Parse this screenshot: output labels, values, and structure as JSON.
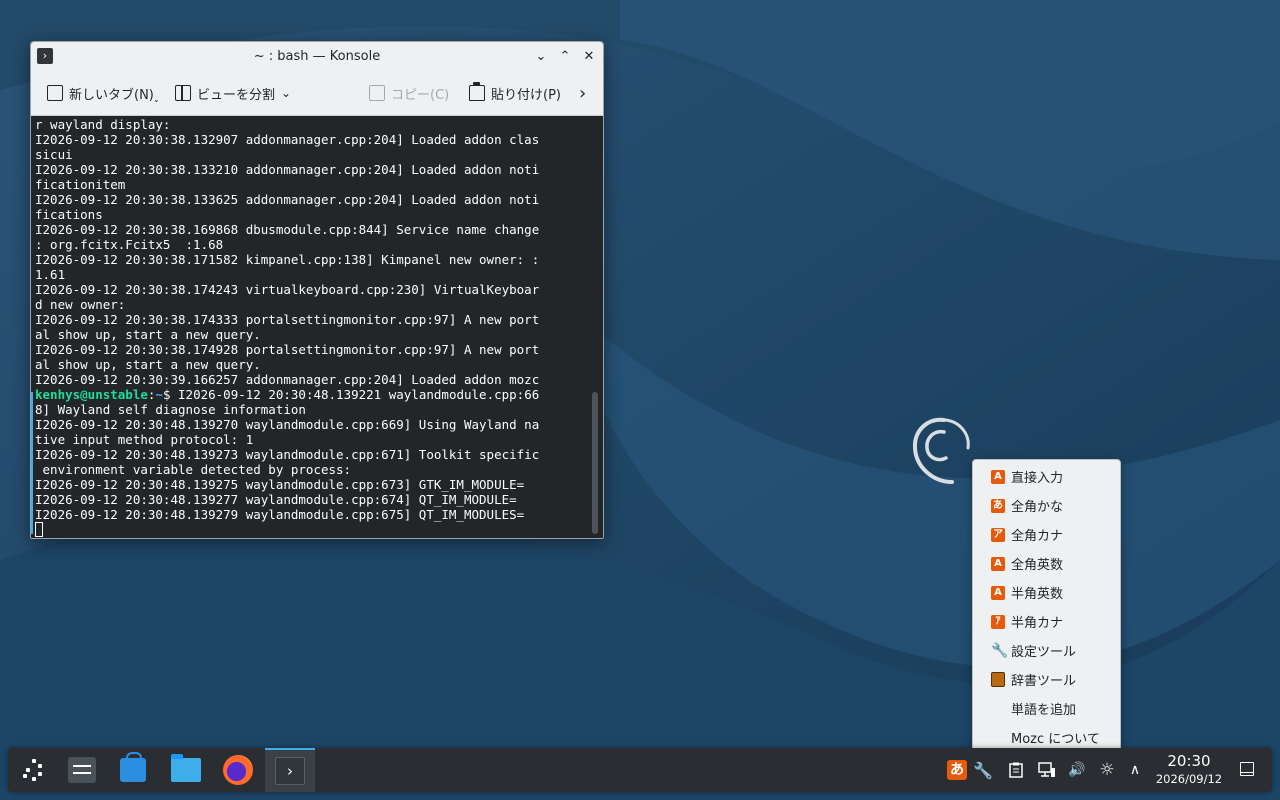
{
  "window": {
    "title": "~ : bash — Konsole",
    "min_glyph": "⌄",
    "max_glyph": "⌃",
    "close_glyph": "✕",
    "app_glyph": "›"
  },
  "toolbar": {
    "new_tab": "新しいタブ(N)",
    "split_view": "ビューを分割",
    "copy": "コピー(C)",
    "paste": "貼り付け(P)",
    "more_glyph": "›"
  },
  "terminal": {
    "lines_before": [
      "r wayland display:",
      "I2026-09-12 20:30:38.132907 addonmanager.cpp:204] Loaded addon clas",
      "sicui",
      "I2026-09-12 20:30:38.133210 addonmanager.cpp:204] Loaded addon noti",
      "ficationitem",
      "I2026-09-12 20:30:38.133625 addonmanager.cpp:204] Loaded addon noti",
      "fications",
      "I2026-09-12 20:30:38.169868 dbusmodule.cpp:844] Service name change",
      ": org.fcitx.Fcitx5  :1.68",
      "I2026-09-12 20:30:38.171582 kimpanel.cpp:138] Kimpanel new owner: :",
      "1.61",
      "I2026-09-12 20:30:38.174243 virtualkeyboard.cpp:230] VirtualKeyboar",
      "d new owner:",
      "I2026-09-12 20:30:38.174333 portalsettingmonitor.cpp:97] A new port",
      "al show up, start a new query.",
      "I2026-09-12 20:30:38.174928 portalsettingmonitor.cpp:97] A new port",
      "al show up, start a new query.",
      "I2026-09-12 20:30:39.166257 addonmanager.cpp:204] Loaded addon mozc"
    ],
    "prompt_user": "kenhys@unstable",
    "prompt_sep": ":",
    "prompt_path": "~",
    "prompt_dollar": "$ ",
    "prompt_rest": "I2026-09-12 20:30:48.139221 waylandmodule.cpp:66",
    "lines_after": [
      "8] Wayland self diagnose information",
      "I2026-09-12 20:30:48.139270 waylandmodule.cpp:669] Using Wayland na",
      "tive input method protocol: 1",
      "I2026-09-12 20:30:48.139273 waylandmodule.cpp:671] Toolkit specific",
      " environment variable detected by process:",
      "I2026-09-12 20:30:48.139275 waylandmodule.cpp:673] GTK_IM_MODULE=",
      "I2026-09-12 20:30:48.139277 waylandmodule.cpp:674] QT_IM_MODULE=",
      "I2026-09-12 20:30:48.139279 waylandmodule.cpp:675] QT_IM_MODULES="
    ]
  },
  "menu": {
    "items": [
      {
        "label": "直接入力",
        "icon": "A"
      },
      {
        "label": "全角かな",
        "icon": "あ"
      },
      {
        "label": "全角カナ",
        "icon": "ア"
      },
      {
        "label": "全角英数",
        "icon": "A"
      },
      {
        "label": "半角英数",
        "icon": "A"
      },
      {
        "label": "半角カナ",
        "icon": "ｱ"
      },
      {
        "label": "設定ツール",
        "icon": "🔧"
      },
      {
        "label": "辞書ツール",
        "icon": ""
      },
      {
        "label": "単語を追加",
        "icon": ""
      },
      {
        "label": "Mozc について",
        "icon": ""
      }
    ]
  },
  "tray": {
    "ime_glyph": "あ",
    "tools_glyph": "🔧",
    "volume_glyph": "🔊",
    "brightness_glyph": "☼",
    "expand_glyph": "∧"
  },
  "clock": {
    "time": "20:30",
    "date": "2026/09/12"
  },
  "taskbar": {
    "konsole_glyph": "›"
  },
  "colors": {
    "accent": "#3daee9",
    "ime_orange": "#e65a0c",
    "prompt_user": "#1cdc9a"
  }
}
